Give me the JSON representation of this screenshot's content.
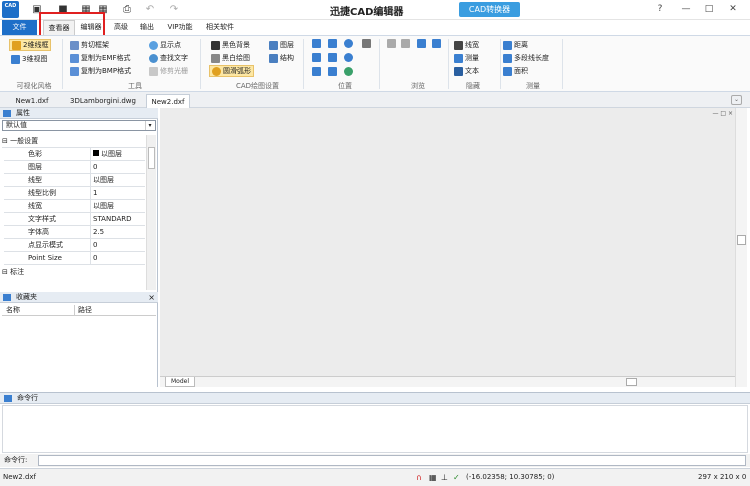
{
  "app": {
    "icon_text": "CAD",
    "title": "迅捷CAD编辑器",
    "converter_button": "CAD转换器"
  },
  "tabs": {
    "file": "文件",
    "viewer": "查看器",
    "editor": "编辑器",
    "advanced": "高级",
    "output": "输出",
    "vip": "VIP功能",
    "related": "相关软件"
  },
  "ribbon": {
    "visual_style": {
      "wireframe_2d": "2维线框",
      "view_3d": "3维视图",
      "group": "可视化风格"
    },
    "tools": {
      "clip_frame": "剪切框架",
      "copy_emf": "复制为EMF格式",
      "copy_bmp": "复制为BMP格式",
      "show_points": "显示点",
      "find_text": "查找文字",
      "trim_raster": "修剪光栅",
      "group": "工具"
    },
    "cad_draw": {
      "black_bg": "黑色背景",
      "bw_drawing": "黑白绘图",
      "smooth_arc": "圆滑弧形",
      "layers": "图层",
      "structure": "结构",
      "group": "CAD绘图设置"
    },
    "position": {
      "group": "位置"
    },
    "browse": {
      "group": "浏览"
    },
    "hide": {
      "line_width": "线宽",
      "measure": "测量",
      "text": "文本",
      "group": "隐藏"
    },
    "measure": {
      "distance": "距离",
      "polyline_length": "多段线长度",
      "area": "面积",
      "group": "测量"
    }
  },
  "documents": [
    "New1.dxf",
    "3DLamborgini.dwg",
    "New2.dxf"
  ],
  "properties": {
    "title": "属性",
    "dropdown_value": "默认值",
    "section_general": "一般设置",
    "rows": [
      {
        "key": "色彩",
        "value": "以图层"
      },
      {
        "key": "图层",
        "value": "0"
      },
      {
        "key": "线型",
        "value": "以图层"
      },
      {
        "key": "线型比例",
        "value": "1"
      },
      {
        "key": "线宽",
        "value": "以图层"
      },
      {
        "key": "文字样式",
        "value": "STANDARD"
      },
      {
        "key": "字体高",
        "value": "2.5"
      },
      {
        "key": "点显示模式",
        "value": "0"
      },
      {
        "key": "Point Size",
        "value": "0"
      }
    ],
    "section_annotation": "标注"
  },
  "favorites": {
    "title": "收藏夹",
    "col_name": "名称",
    "col_path": "路径"
  },
  "canvas": {
    "model_tab": "Model"
  },
  "command": {
    "title": "命令行",
    "prompt_label": "命令行:"
  },
  "status": {
    "filename": "New2.dxf",
    "coordinates": "(-16.02358; 10.30785; 0)",
    "paper_size": "297 x 210 x 0"
  },
  "colors": {
    "file_tab": "#1e6fc8",
    "converter": "#3a9de0",
    "highlight_box": "#e02020",
    "selected_button": "#fde7a3",
    "canvas": "#ececec"
  }
}
